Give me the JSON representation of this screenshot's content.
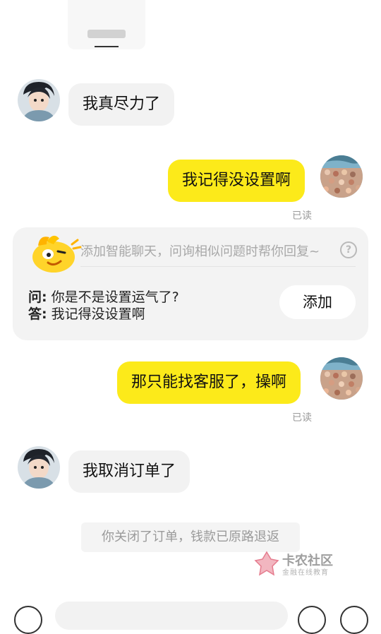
{
  "messages": [
    {
      "side": "left",
      "text": "我真尽力了"
    },
    {
      "side": "right",
      "text": "我记得没设置啊",
      "status": "已读"
    },
    {
      "side": "right",
      "text": "那只能找客服了，操啊",
      "status": "已读"
    },
    {
      "side": "left",
      "text": "我取消订单了"
    }
  ],
  "smart_reply": {
    "hint": "添加智能聊天，问询相似问题时帮你回复~",
    "help_icon": "question-circle-icon",
    "question_label": "问:",
    "question": "你是不是设置运气了?",
    "answer_label": "答:",
    "answer": "我记得没设置啊",
    "add_button": "添加"
  },
  "system_notice": "你关闭了订单，钱款已原路退返",
  "watermark": {
    "title": "卡农社区",
    "subtitle": "金融在线教育"
  },
  "colors": {
    "right_bubble": "#fcea1a",
    "left_bubble": "#f2f2f2",
    "card_bg": "#f3f3f3",
    "muted_text": "#9a9a9a"
  }
}
